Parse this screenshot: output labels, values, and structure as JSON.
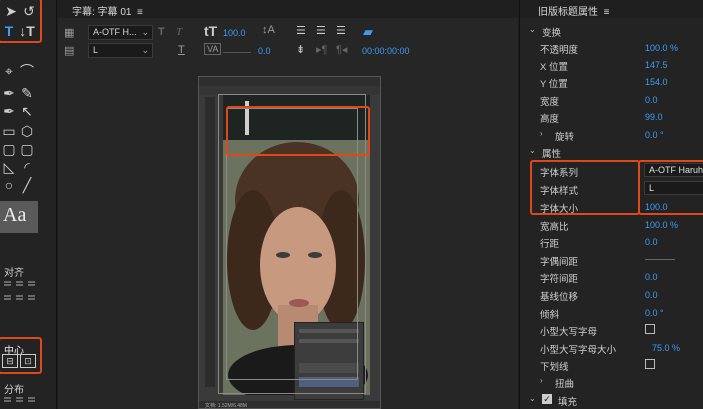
{
  "left_panel": {
    "section_align": "对齐",
    "section_center": "中心",
    "section_distribute": "分布",
    "text_style_sample": "Aa"
  },
  "title_panel": {
    "tab_title": "字幕: 字幕 01",
    "tab_menu": "≡",
    "font_family": "A-OTF H...",
    "font_style": "L",
    "font_size": "100.0",
    "kerning": "0.0",
    "timecode": "00:00:00:00"
  },
  "photoshop_embed": {
    "status": "文档: 1.52M/6.48M"
  },
  "properties": {
    "title": "旧版标题属性",
    "menu": "≡",
    "transform": {
      "section": "变换",
      "opacity_label": "不透明度",
      "opacity_value": "100.0 %",
      "x_label": "X 位置",
      "x_value": "147.5",
      "y_label": "Y 位置",
      "y_value": "154.0",
      "width_label": "宽度",
      "width_value": "0.0",
      "height_label": "高度",
      "height_value": "99.0",
      "rotation_label": "旋转",
      "rotation_value": "0.0 °"
    },
    "attributes": {
      "section": "属性",
      "font_family_label": "字体系列",
      "font_family_value": "A-OTF Haruh",
      "font_style_label": "字体样式",
      "font_style_value": "L",
      "font_size_label": "字体大小",
      "font_size_value": "100.0",
      "aspect_label": "宽高比",
      "aspect_value": "100.0 %",
      "leading_label": "行距",
      "leading_value": "0.0",
      "kerning_label": "字偶间距",
      "tracking_label": "字符间距",
      "tracking_value": "0.0",
      "baseline_label": "基线位移",
      "baseline_value": "0.0",
      "slant_label": "倾斜",
      "slant_value": "0.0 °",
      "smallcaps_label": "小型大写字母",
      "smallcaps_size_label": "小型大写字母大小",
      "smallcaps_size_value": "75.0 %",
      "underline_label": "下划线",
      "distort_label": "扭曲"
    },
    "fill": {
      "section": "填充"
    }
  },
  "accent_color": "#3d9df5",
  "highlight_color": "#e0481b"
}
